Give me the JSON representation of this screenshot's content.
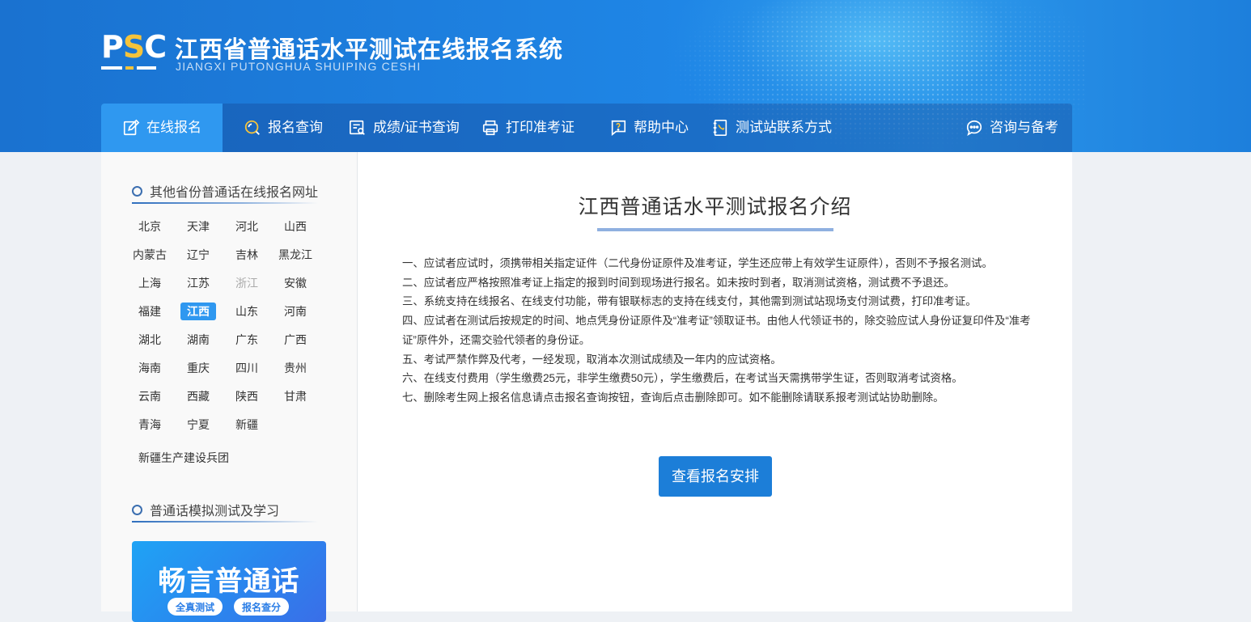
{
  "header": {
    "logo": "PSC",
    "title": "江西省普通话水平测试在线报名系统",
    "subtitle": "JIANGXI PUTONGHUA SHUIPING CESHI"
  },
  "nav": {
    "items": [
      {
        "label": "在线报名",
        "icon": "edit-icon"
      },
      {
        "label": "报名查询",
        "icon": "search-icon"
      },
      {
        "label": "成绩/证书查询",
        "icon": "certificate-search-icon"
      },
      {
        "label": "打印准考证",
        "icon": "printer-icon"
      },
      {
        "label": "帮助中心",
        "icon": "help-icon"
      },
      {
        "label": "测试站联系方式",
        "icon": "contact-book-icon"
      },
      {
        "label": "咨询与备考",
        "icon": "chat-icon"
      }
    ],
    "active_index": 0
  },
  "sidebar": {
    "provinces_heading": "其他省份普通话在线报名网址",
    "provinces": [
      "北京",
      "天津",
      "河北",
      "山西",
      "内蒙古",
      "辽宁",
      "吉林",
      "黑龙江",
      "上海",
      "江苏",
      "浙江",
      "安徽",
      "福建",
      "江西",
      "山东",
      "河南",
      "湖北",
      "湖南",
      "广东",
      "广西",
      "海南",
      "重庆",
      "四川",
      "贵州",
      "云南",
      "西藏",
      "陕西",
      "甘肃",
      "青海",
      "宁夏",
      "新疆"
    ],
    "current_province": "江西",
    "disabled_province": "浙江",
    "xpcc": "新疆生产建设兵团",
    "practice_heading": "普通话模拟测试及学习",
    "promo": {
      "title": "畅言普通话",
      "buttons": [
        "全真测试",
        "报名查分"
      ]
    }
  },
  "main": {
    "title": "江西普通话水平测试报名介绍",
    "rules": [
      "一、应试者应试时，须携带相关指定证件（二代身份证原件及准考证，学生还应带上有效学生证原件），否则不予报名测试。",
      "二、应试者应严格按照准考证上指定的报到时间到现场进行报名。如未按时到者，取消测试资格，测试费不予退还。",
      "三、系统支持在线报名、在线支付功能，带有银联标志的支持在线支付，其他需到测试站现场支付测试费，打印准考证。",
      "四、应试者在测试后按规定的时间、地点凭身份证原件及“准考证”领取证书。由他人代领证书的，除交验应试人身份证复印件及“准考证”原件外，还需交验代领者的身份证。",
      "五、考试严禁作弊及代考，一经发现，取消本次测试成绩及一年内的应试资格。",
      "六、在线支付费用（学生缴费25元，非学生缴费50元），学生缴费后，在考试当天需携带学生证，否则取消考试资格。",
      "七、删除考生网上报名信息请点击报名查询按钮，查询后点击删除即可。如不能删除请联系报考测试站协助删除。"
    ],
    "cta": "查看报名安排"
  }
}
